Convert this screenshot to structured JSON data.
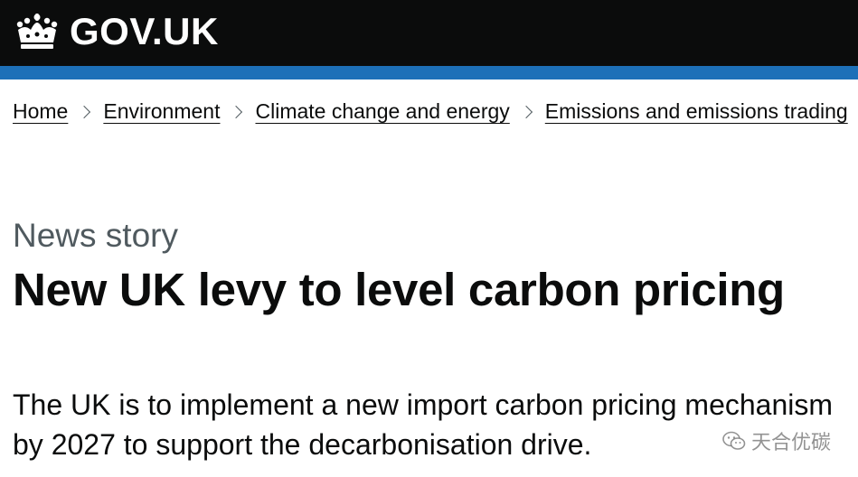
{
  "header": {
    "logo_text": "GOV.UK",
    "crown_icon": "crown-icon"
  },
  "colors": {
    "header_bg": "#0b0c0c",
    "stripe": "#1d70b8",
    "secondary_text": "#505a5f"
  },
  "breadcrumbs": [
    {
      "label": "Home"
    },
    {
      "label": "Environment"
    },
    {
      "label": "Climate change and energy"
    },
    {
      "label": "Emissions and emissions trading"
    }
  ],
  "article": {
    "caption": "News story",
    "title": "New UK levy to level carbon pricing",
    "lead": "The UK is to implement a new import carbon pricing mechanism by 2027 to support the decarbonisation drive."
  },
  "watermark": {
    "text": "天合优碳",
    "icon": "wechat-icon"
  }
}
